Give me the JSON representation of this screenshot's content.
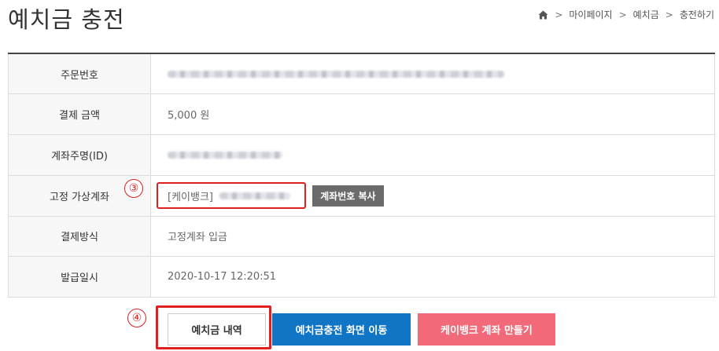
{
  "page": {
    "title": "예치금 충전"
  },
  "breadcrumb": {
    "home_icon": "home-icon",
    "items": [
      "마이페이지",
      "예치금",
      "충전하기"
    ],
    "separator": ">"
  },
  "rows": {
    "order_no": {
      "label": "주문번호"
    },
    "amount": {
      "label": "결제 금액",
      "value": "5,000 원"
    },
    "depositor": {
      "label": "계좌주명(ID)"
    },
    "vaccount": {
      "label": "고정 가상계좌",
      "bank": "[케이뱅크]",
      "copy_label": "계좌번호 복사"
    },
    "method": {
      "label": "결제방식",
      "value": "고정계좌 입금"
    },
    "issued": {
      "label": "발급일시",
      "value": "2020-10-17 12:20:51"
    }
  },
  "annotations": {
    "marker_3": "③",
    "marker_4": "④"
  },
  "buttons": {
    "history": "예치금 내역",
    "charge": "예치금충전 화면 이동",
    "kbank": "케이뱅크 계좌 만들기"
  },
  "colors": {
    "amount": "#c0392b",
    "highlight": "#e02020",
    "primary": "#1175c6",
    "kbank": "#f26a7a",
    "copy_button": "#6b6b6b"
  }
}
